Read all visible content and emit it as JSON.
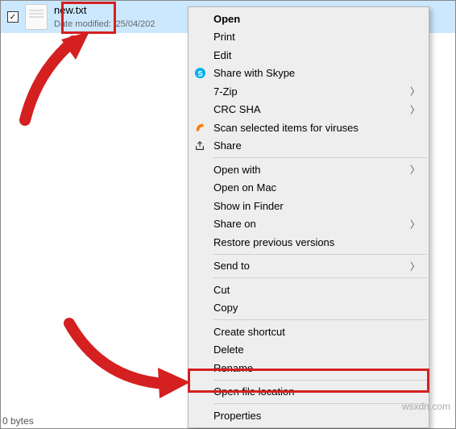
{
  "file": {
    "name": "new.txt",
    "modified_label": "Date modified:",
    "modified_date": "25/04/202",
    "checked": "✓"
  },
  "menu": {
    "open": "Open",
    "print": "Print",
    "edit": "Edit",
    "skype": "Share with Skype",
    "sevenzip": "7-Zip",
    "crc": "CRC SHA",
    "scan": "Scan selected items for viruses",
    "share": "Share",
    "open_with": "Open with",
    "open_mac": "Open on Mac",
    "show_finder": "Show in Finder",
    "share_on": "Share on",
    "restore": "Restore previous versions",
    "send_to": "Send to",
    "cut": "Cut",
    "copy": "Copy",
    "create_shortcut": "Create shortcut",
    "delete": "Delete",
    "rename": "Rename",
    "open_location": "Open file location",
    "properties": "Properties"
  },
  "icons": {
    "skype_color": "#00aff0",
    "scan_color": "#ff7a00",
    "share_glyph": "↗"
  },
  "watermark": "wsxdn.com",
  "bottom": "0 bytes",
  "annotations": {
    "arrow_color": "#d42020"
  }
}
